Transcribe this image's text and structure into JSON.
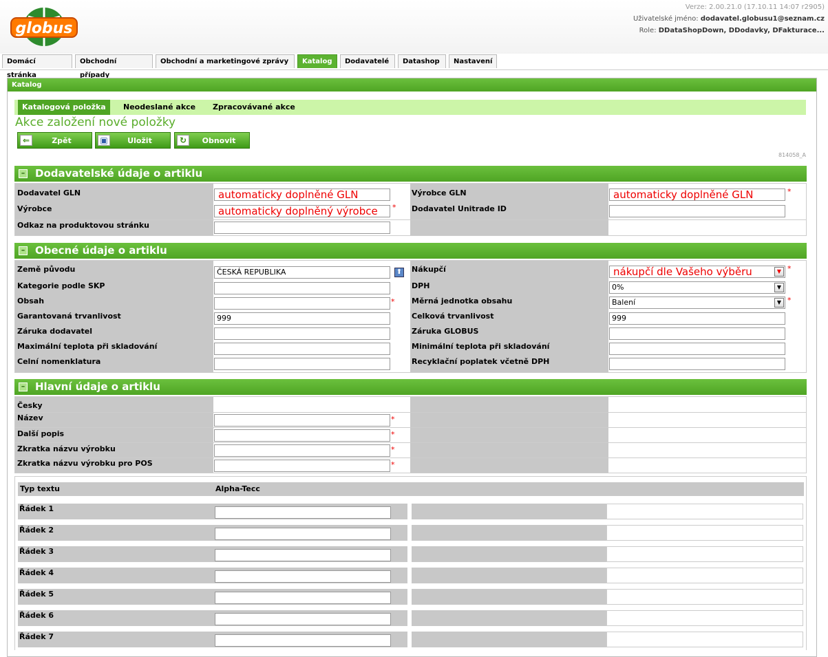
{
  "header": {
    "logo_text": "globus",
    "version": "Verze: 2.00.21.0 (17.10.11 14:07 r2905)",
    "user_label": "Uživatelské jméno:",
    "user_value": "dodavatel.globusu1@seznam.cz",
    "role_label": "Role:",
    "role_value": "DDataShopDown, DDodavky, DFakturace..."
  },
  "tabs": [
    "Domácí stránka",
    "Obchodní případy",
    "Obchodní a marketingové zprávy",
    "Katalog",
    "Dodavatelé",
    "Datashop",
    "Nastavení"
  ],
  "active_tab": "Katalog",
  "panel": {
    "title": "Katalog"
  },
  "subtabs": [
    "Katalogová položka",
    "Neodeslané akce",
    "Zpracovávané akce"
  ],
  "page_title": "Akce založení nové položky",
  "buttons": {
    "back": "Zpět",
    "save": "Uložit",
    "refresh": "Obnovit"
  },
  "page_code": "814058_A",
  "supplier_section": {
    "title": "Dodavatelské údaje o artiklu",
    "supplier_gln_label": "Dodavatel GLN",
    "supplier_gln_value": "automaticky doplněné GLN",
    "manufacturer_gln_label": "Výrobce GLN",
    "manufacturer_gln_value": "automaticky doplněné GLN",
    "manufacturer_label": "Výrobce",
    "manufacturer_value": "automaticky doplněný výrobce",
    "unitrade_label": "Dodavatel Unitrade ID",
    "unitrade_value": "",
    "product_link_label": "Odkaz na produktovou stránku",
    "product_link_value": ""
  },
  "general_section": {
    "title": "Obecné údaje o artiklu",
    "origin_label": "Země původu",
    "origin_value": "ČESKÁ REPUBLIKA",
    "buyer_label": "Nákupčí",
    "buyer_value": "nákupčí dle Vašeho výběru",
    "skp_label": "Kategorie podle SKP",
    "skp_value": "",
    "vat_label": "DPH",
    "vat_value": "0%",
    "content_label": "Obsah",
    "content_value": "",
    "unit_label": "Měrná jednotka obsahu",
    "unit_value": "Balení",
    "guaranteed_shelf_label": "Garantovaná trvanlivost",
    "guaranteed_shelf_value": "999",
    "total_shelf_label": "Celková trvanlivost",
    "total_shelf_value": "999",
    "supplier_warranty_label": "Záruka dodavatel",
    "supplier_warranty_value": "",
    "globus_warranty_label": "Záruka GLOBUS",
    "globus_warranty_value": "",
    "max_temp_label": "Maximální teplota při skladování",
    "max_temp_value": "",
    "min_temp_label": "Minimální teplota při skladování",
    "min_temp_value": "",
    "customs_label": "Celní nomenklatura",
    "customs_value": "",
    "recycling_label": "Recyklační poplatek včetně DPH",
    "recycling_value": ""
  },
  "main_section": {
    "title": "Hlavní údaje o artiklu",
    "language_label": "Česky",
    "name_label": "Název",
    "description_label": "Další popis",
    "short_name_label": "Zkratka názvu výrobku",
    "short_name_pos_label": "Zkratka názvu výrobku pro POS",
    "text_type_header": "Typ textu",
    "alpha_header": "Alpha-Tecc",
    "rows": [
      "Řádek 1",
      "Řádek 2",
      "Řádek 3",
      "Řádek 4",
      "Řádek 5",
      "Řádek 6",
      "Řádek 7"
    ]
  },
  "colors": {
    "accent": "#5cb331",
    "required": "#e00000",
    "label_bg": "#c8c8c8"
  }
}
